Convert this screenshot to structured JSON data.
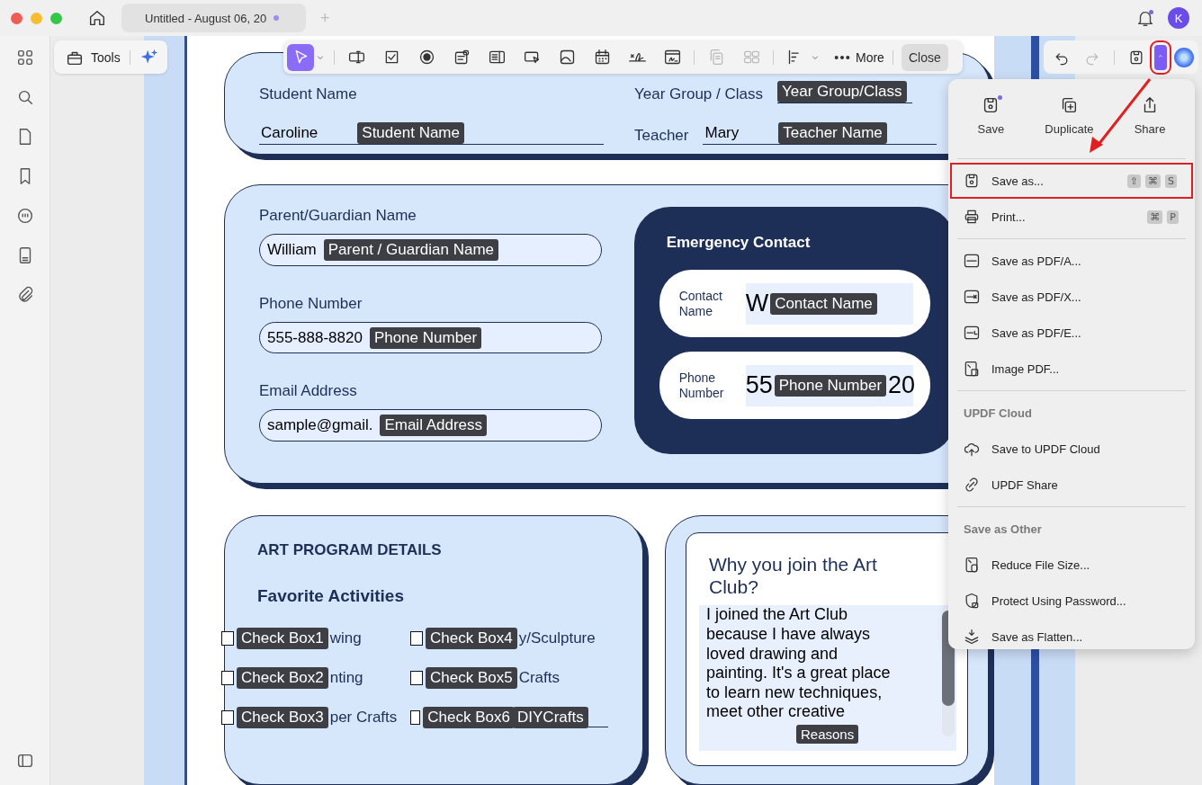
{
  "window": {
    "tab_title": "Untitled - August 06, 20",
    "tab_modified": true,
    "new_tab": "+",
    "avatar": "K",
    "notification": true
  },
  "tools_panel": {
    "label": "Tools"
  },
  "toolbar": {
    "tools": [
      {
        "kind": "pointer",
        "selected": true,
        "disabled": false
      },
      {
        "kind": "textfield",
        "selected": false,
        "disabled": false
      },
      {
        "kind": "checkbox",
        "selected": false,
        "disabled": false
      },
      {
        "kind": "radio",
        "selected": false,
        "disabled": false
      },
      {
        "kind": "combo",
        "selected": false,
        "disabled": false
      },
      {
        "kind": "list",
        "selected": false,
        "disabled": false
      },
      {
        "kind": "okbutton",
        "selected": false,
        "disabled": false
      },
      {
        "kind": "image",
        "selected": false,
        "disabled": false
      },
      {
        "kind": "calendar",
        "selected": false,
        "disabled": false
      },
      {
        "kind": "signature",
        "selected": false,
        "disabled": false
      },
      {
        "kind": "digisign",
        "selected": false,
        "disabled": false
      },
      {
        "kind": "copy",
        "selected": false,
        "disabled": true
      },
      {
        "kind": "grid",
        "selected": false,
        "disabled": true
      },
      {
        "kind": "align",
        "selected": false,
        "disabled": false
      }
    ],
    "more": "More",
    "close": "Close"
  },
  "right_toolbar": {
    "undo_disabled": false,
    "redo_disabled": true,
    "menu_expanded": true,
    "menu_highlighted": true
  },
  "form": {
    "card1": {
      "student": {
        "label": "Student Name",
        "value": "Caroline",
        "tag": "Student Name"
      },
      "year": {
        "label": "Year Group / Class",
        "tag": "Year Group/Class"
      },
      "teacher": {
        "label": "Teacher",
        "value": "Mary",
        "tag": "Teacher Name"
      }
    },
    "card2": {
      "fields": [
        {
          "label": "Parent/Guardian Name",
          "value": "William",
          "tag": "Parent / Guardian Name"
        },
        {
          "label": "Phone Number",
          "value": "555-888-8820",
          "tag": "Phone Number"
        },
        {
          "label": "Email Address",
          "value": "sample@gmail.",
          "tag": "Email Address"
        }
      ],
      "emergency": {
        "title": "Emergency Contact",
        "rows": [
          {
            "label": "Contact Name",
            "value_start": "W",
            "tag": "Contact Name"
          },
          {
            "label": "Phone Number",
            "value_start": "55",
            "tag": "Phone Number",
            "value_end": "20"
          }
        ]
      }
    },
    "card3": {
      "title": "ART PROGRAM DETAILS",
      "subtitle": "Favorite Activities",
      "checkboxes": [
        {
          "tag": "Check Box1",
          "text": "wing",
          "checked": false
        },
        {
          "tag": "Check Box4",
          "text": "y/Sculpture",
          "checked": false
        },
        {
          "tag": "Check Box2",
          "text": "nting",
          "checked": false
        },
        {
          "tag": "Check Box5",
          "text": "Crafts",
          "checked": false
        },
        {
          "tag": "Check Box3",
          "text": "per Crafts",
          "checked": false
        },
        {
          "tag": "Check Box6",
          "field_tag": "DIYCrafts",
          "checked": false
        }
      ]
    },
    "card4": {
      "question": "Why you join the Art Club?",
      "answer": [
        "I joined the Art Club",
        "because I have always",
        "loved drawing and",
        "painting. It's a great place",
        "to learn new techniques,",
        "meet other creative"
      ],
      "tag": "Reasons"
    }
  },
  "menu": {
    "actions": [
      {
        "label": "Save",
        "kind": "save",
        "badge": true
      },
      {
        "label": "Duplicate",
        "kind": "duplicate",
        "badge": false
      },
      {
        "label": "Share",
        "kind": "share",
        "badge": false
      }
    ],
    "sections": [
      {
        "items": [
          {
            "label": "Save as...",
            "kind": "save",
            "shortcut": [
              "⇧",
              "⌘",
              "S"
            ],
            "highlighted": true
          },
          {
            "label": "Print...",
            "kind": "print",
            "shortcut": [
              "⌘",
              "P"
            ],
            "highlighted": false
          }
        ]
      },
      {
        "items": [
          {
            "label": "Save as PDF/A...",
            "kind": "pdfa",
            "highlighted": false
          },
          {
            "label": "Save as PDF/X...",
            "kind": "pdfx",
            "highlighted": false
          },
          {
            "label": "Save as PDF/E...",
            "kind": "pdfe",
            "highlighted": false
          },
          {
            "label": "Image PDF...",
            "kind": "imagepdf",
            "highlighted": false
          }
        ]
      },
      {
        "heading": "UPDF Cloud",
        "items": [
          {
            "label": "Save to UPDF Cloud",
            "kind": "cloud",
            "highlighted": false
          },
          {
            "label": "UPDF Share",
            "kind": "link",
            "highlighted": false
          }
        ]
      },
      {
        "heading": "Save as Other",
        "items": [
          {
            "label": "Reduce File Size...",
            "kind": "reduce",
            "highlighted": false
          },
          {
            "label": "Protect Using Password...",
            "kind": "protect",
            "highlighted": false
          },
          {
            "label": "Save as Flatten...",
            "kind": "flatten",
            "highlighted": false
          }
        ]
      }
    ]
  }
}
